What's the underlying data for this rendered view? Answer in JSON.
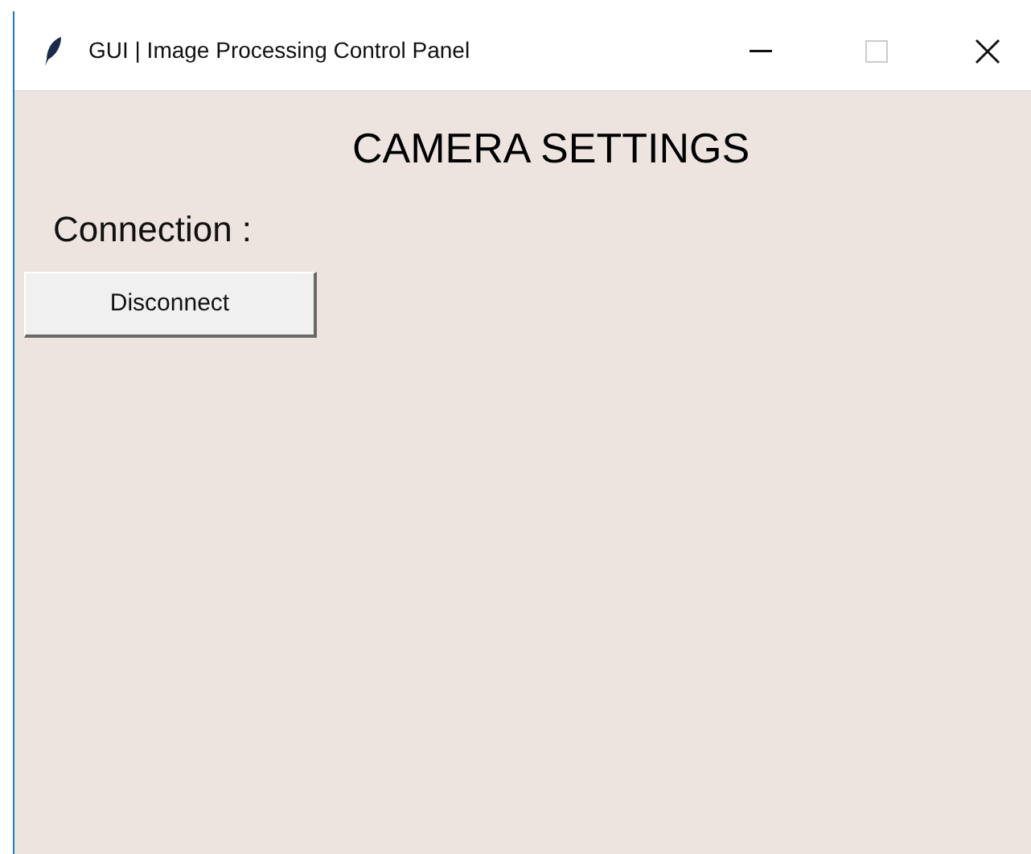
{
  "window": {
    "title": "GUI | Image Processing Control Panel"
  },
  "heading": "CAMERA SETTINGS",
  "connection_label": "Connection :",
  "buttons": [
    {
      "label": "Disconnect"
    }
  ]
}
